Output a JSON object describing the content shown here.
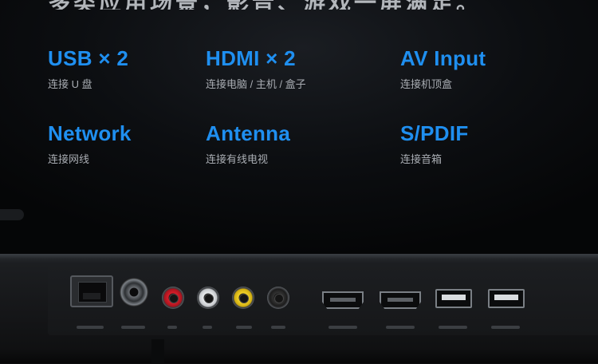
{
  "headline": "多类应用场景，影音、游戏一屏满足。",
  "ports": [
    {
      "name": "USB × 2",
      "desc": "连接 U 盘"
    },
    {
      "name": "HDMI × 2",
      "desc": "连接电脑 / 主机 / 盒子"
    },
    {
      "name": "AV Input",
      "desc": "连接机顶盒"
    },
    {
      "name": "Network",
      "desc": "连接网线"
    },
    {
      "name": "Antenna",
      "desc": "连接有线电视"
    },
    {
      "name": "S/PDIF",
      "desc": "连接音箱"
    }
  ],
  "colors": {
    "accent": "#1f8ff0",
    "rca_red": "#d81e2a",
    "rca_white": "#e9ebed",
    "rca_yellow": "#f2d22a"
  }
}
